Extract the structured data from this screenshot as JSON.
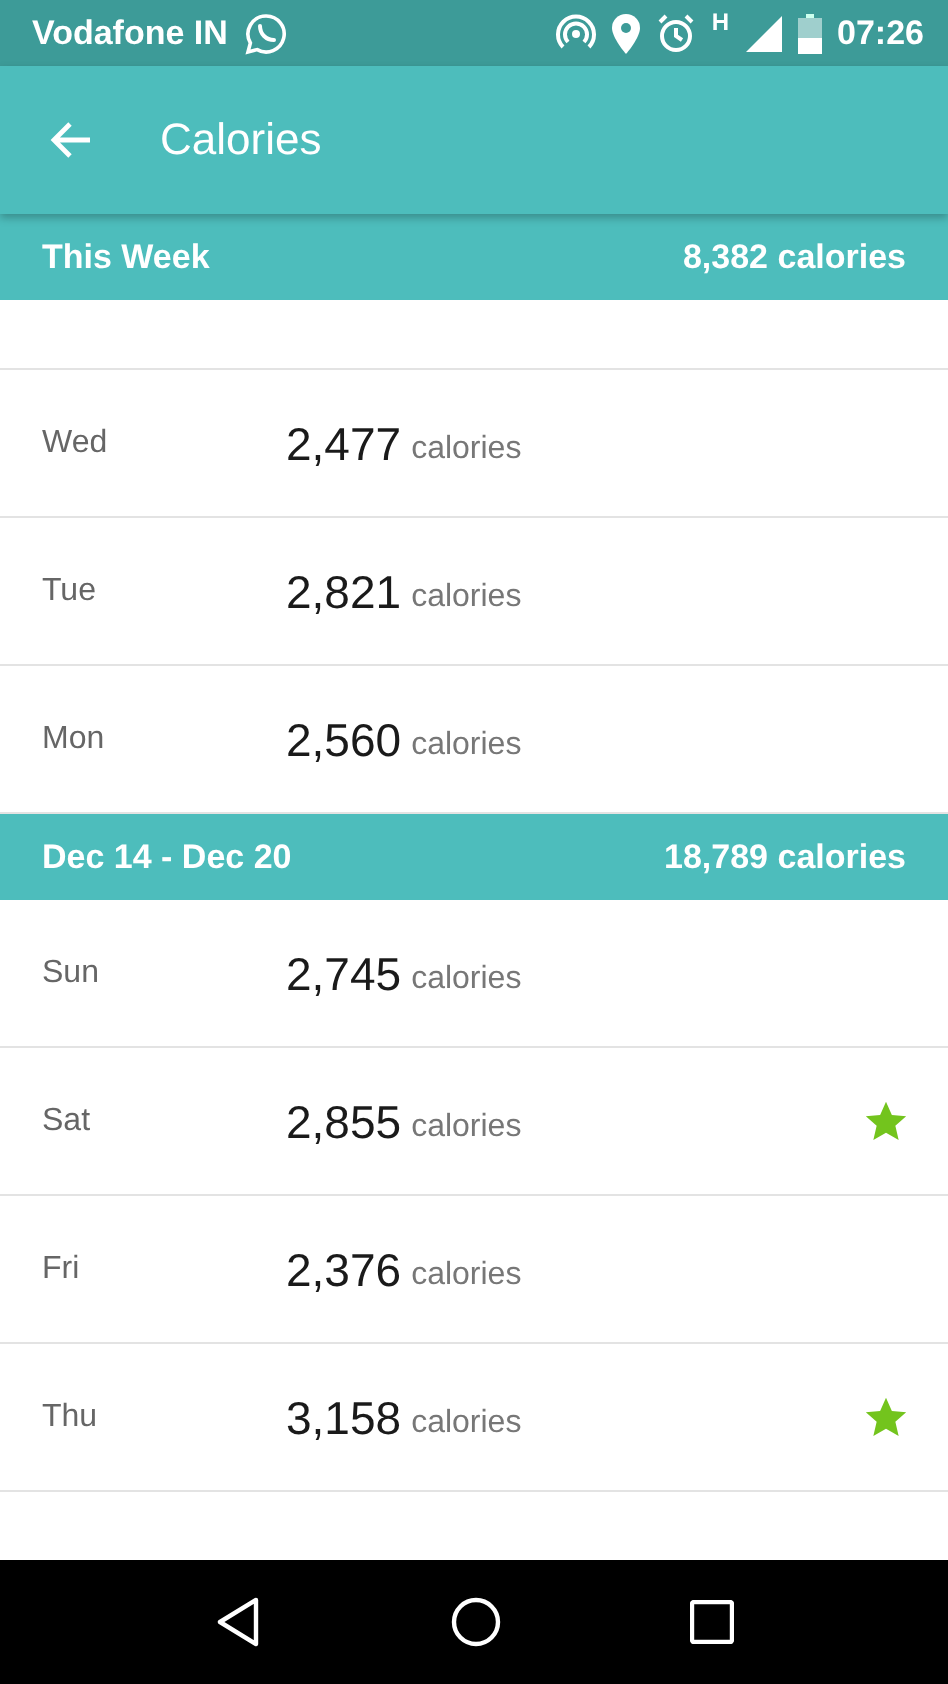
{
  "status_bar": {
    "carrier": "Vodafone IN",
    "network": "H",
    "time": "07:26"
  },
  "app_bar": {
    "title": "Calories"
  },
  "sections": [
    {
      "title": "This Week",
      "total": "8,382 calories",
      "days": [
        {
          "day": "Wed",
          "value": "2,477",
          "unit": "calories",
          "star": false
        },
        {
          "day": "Tue",
          "value": "2,821",
          "unit": "calories",
          "star": false
        },
        {
          "day": "Mon",
          "value": "2,560",
          "unit": "calories",
          "star": false
        }
      ]
    },
    {
      "title": "Dec 14 - Dec 20",
      "total": "18,789 calories",
      "days": [
        {
          "day": "Sun",
          "value": "2,745",
          "unit": "calories",
          "star": false
        },
        {
          "day": "Sat",
          "value": "2,855",
          "unit": "calories",
          "star": true
        },
        {
          "day": "Fri",
          "value": "2,376",
          "unit": "calories",
          "star": false
        },
        {
          "day": "Thu",
          "value": "3,158",
          "unit": "calories",
          "star": true
        }
      ]
    }
  ]
}
